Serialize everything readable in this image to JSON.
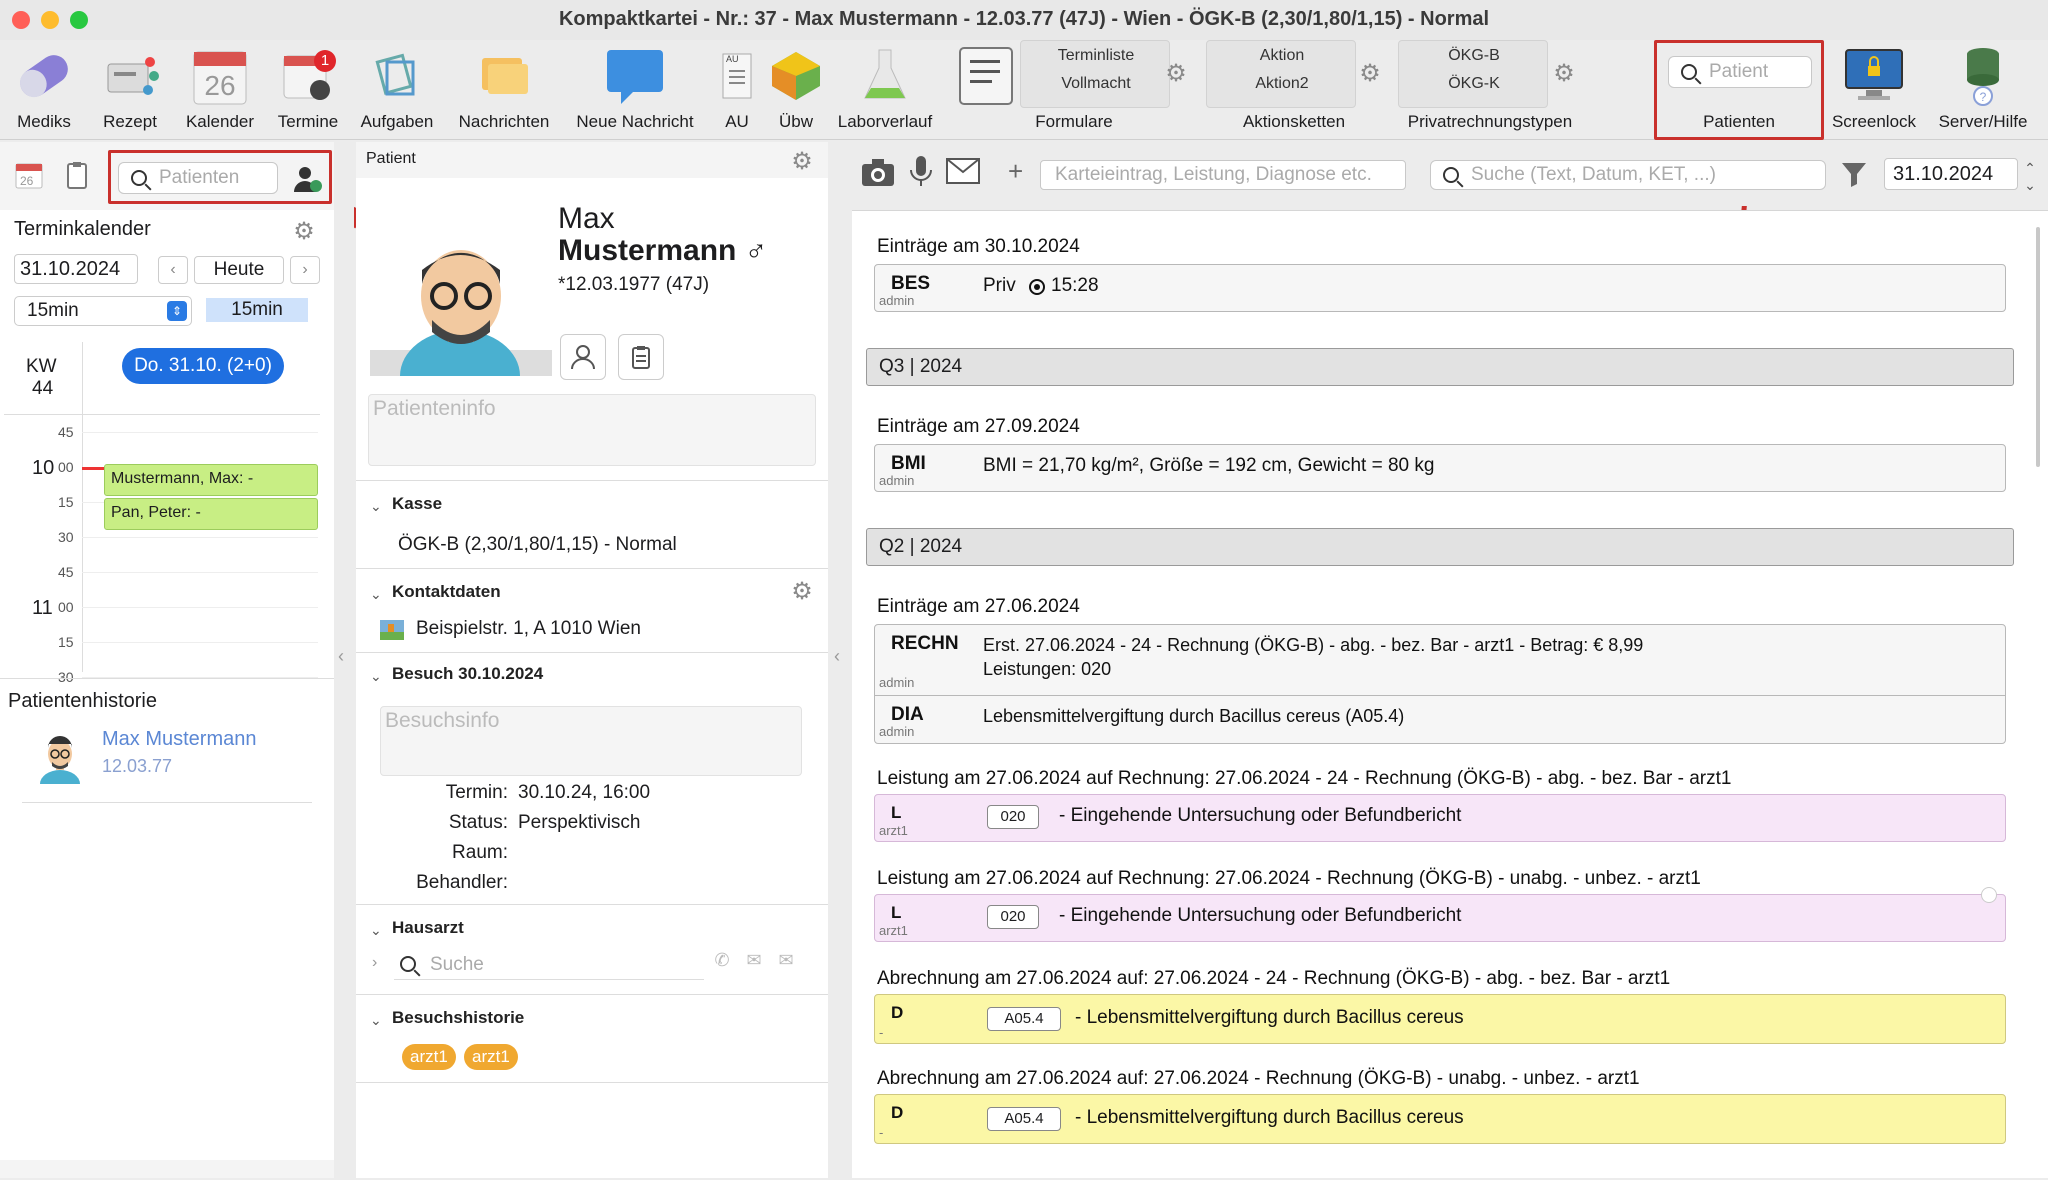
{
  "window": {
    "title": "Kompaktkartei - Nr.: 37 - Max Mustermann - 12.03.77 (47J) - Wien - ÖGK-B (2,30/1,80/1,15) - Normal",
    "colors": {
      "close": "#ff5f57",
      "minimize": "#febc2e",
      "zoom": "#28c840",
      "highlight": "#c9302c",
      "accent": "#1f6fe0"
    }
  },
  "toolbar": {
    "mediks": "Mediks",
    "rezept": "Rezept",
    "kalender": "Kalender",
    "kalender_day": "26",
    "termine": "Termine",
    "termine_badge": "1",
    "aufgaben": "Aufgaben",
    "nachrichten": "Nachrichten",
    "neue_nachricht": "Neue Nachricht",
    "au": "AU",
    "au_icon_text": "AU",
    "uebw": "Übw",
    "laborverlauf": "Laborverlauf",
    "formulare": {
      "line1": "Terminliste",
      "line2": "Vollmacht",
      "label": "Formulare"
    },
    "aktionsketten": {
      "line1": "Aktion",
      "line2": "Aktion2",
      "label": "Aktionsketten"
    },
    "privat": {
      "line1": "ÖKG-B",
      "line2": "ÖKG-K",
      "label": "Privatrechnungstypen"
    },
    "patient_search_placeholder": "Patient",
    "patienten": "Patienten",
    "screenlock": "Screenlock",
    "server_hilfe": "Server/Hilfe"
  },
  "left": {
    "mini_calendar_day": "26",
    "search_placeholder": "Patienten",
    "terminkalender": "Terminkalender",
    "date": "31.10.2024",
    "heute": "Heute",
    "interval": "15min",
    "interval_chip": "15min",
    "kw_label": "KW",
    "kw_number": "44",
    "day_pill": "Do. 31.10. (2+0)",
    "times": [
      {
        "h": "",
        "m": "45"
      },
      {
        "h": "10",
        "m": "00"
      },
      {
        "h": "",
        "m": "15"
      },
      {
        "h": "",
        "m": "30"
      },
      {
        "h": "",
        "m": "45"
      },
      {
        "h": "11",
        "m": "00"
      },
      {
        "h": "",
        "m": "15"
      },
      {
        "h": "",
        "m": "30"
      }
    ],
    "appointments": [
      "Mustermann, Max:  -",
      "Pan, Peter:  -"
    ],
    "historie_title": "Patientenhistorie",
    "history_name": "Max Mustermann",
    "history_dob": "12.03.77"
  },
  "middle": {
    "header": "Patient",
    "first_name": "Max",
    "last_name": "Mustermann",
    "gender_symbol": "♂",
    "dob": "*12.03.1977 (47J)",
    "info_placeholder": "Patienteninfo",
    "kasse_h": "Kasse",
    "kasse": "ÖGK-B (2,30/1,80/1,15) - Normal",
    "kontakt_h": "Kontaktdaten",
    "address": "Beispielstr. 1, A 1010 Wien",
    "besuch_h": "Besuch 30.10.2024",
    "besuch_placeholder": "Besuchsinfo",
    "termin_l": "Termin:",
    "termin_v": "30.10.24, 16:00",
    "status_l": "Status:",
    "status_v": "Perspektivisch",
    "raum_l": "Raum:",
    "behandler_l": "Behandler:",
    "hausarzt_h": "Hausarzt",
    "hausarzt_search": "Suche",
    "besuchshist_h": "Besuchshistorie",
    "tags": [
      "arzt1",
      "arzt1"
    ]
  },
  "right": {
    "entry_placeholder": "Karteieintrag, Leistung, Diagnose etc.",
    "search_placeholder": "Suche (Text, Datum, KET, ...)",
    "date": "31.10.2024",
    "head1": "Einträge am 30.10.2024",
    "bes": {
      "code": "BES",
      "who": "admin",
      "text": "Priv",
      "time": "15:28"
    },
    "q3": "Q3 | 2024",
    "head2": "Einträge am 27.09.2024",
    "bmi": {
      "code": "BMI",
      "who": "admin",
      "text": "BMI = 21,70 kg/m², Größe = 192 cm, Gewicht = 80 kg"
    },
    "q2": "Q2 | 2024",
    "head3": "Einträge am 27.06.2024",
    "rechn": {
      "code": "RECHN",
      "who": "admin",
      "line1": "Erst. 27.06.2024 - 24 - Rechnung (ÖKG-B) - abg. - bez. Bar - arzt1 - Betrag: € 8,99",
      "line2": "Leistungen: 020"
    },
    "dia": {
      "code": "DIA",
      "who": "admin",
      "text": "Lebensmittelvergiftung durch Bacillus cereus (A05.4)"
    },
    "head4": "Leistung am 27.06.2024 auf Rechnung: 27.06.2024 - 24 - Rechnung (ÖKG-B) - abg. - bez. Bar - arzt1",
    "l1": {
      "code": "L",
      "who": "arzt1",
      "badge": "020",
      "text": "- Eingehende Untersuchung oder Befundbericht"
    },
    "head5": "Leistung am 27.06.2024 auf Rechnung: 27.06.2024 - Rechnung (ÖKG-B) - unabg. - unbez. - arzt1",
    "l2": {
      "code": "L",
      "who": "arzt1",
      "badge": "020",
      "text": "- Eingehende Untersuchung oder Befundbericht"
    },
    "head6": "Abrechnung am 27.06.2024 auf: 27.06.2024 - 24 - Rechnung (ÖKG-B) - abg. - bez. Bar - arzt1",
    "d1": {
      "code": "D",
      "who": "-",
      "badge": "A05.4",
      "text": "- Lebensmittelvergiftung durch Bacillus cereus"
    },
    "head7": "Abrechnung am 27.06.2024 auf: 27.06.2024 - Rechnung (ÖKG-B) - unabg. - unbez. - arzt1",
    "d2": {
      "code": "D",
      "who": "-",
      "badge": "A05.4",
      "text": "- Lebensmittelvergiftung durch Bacillus cereus"
    }
  }
}
